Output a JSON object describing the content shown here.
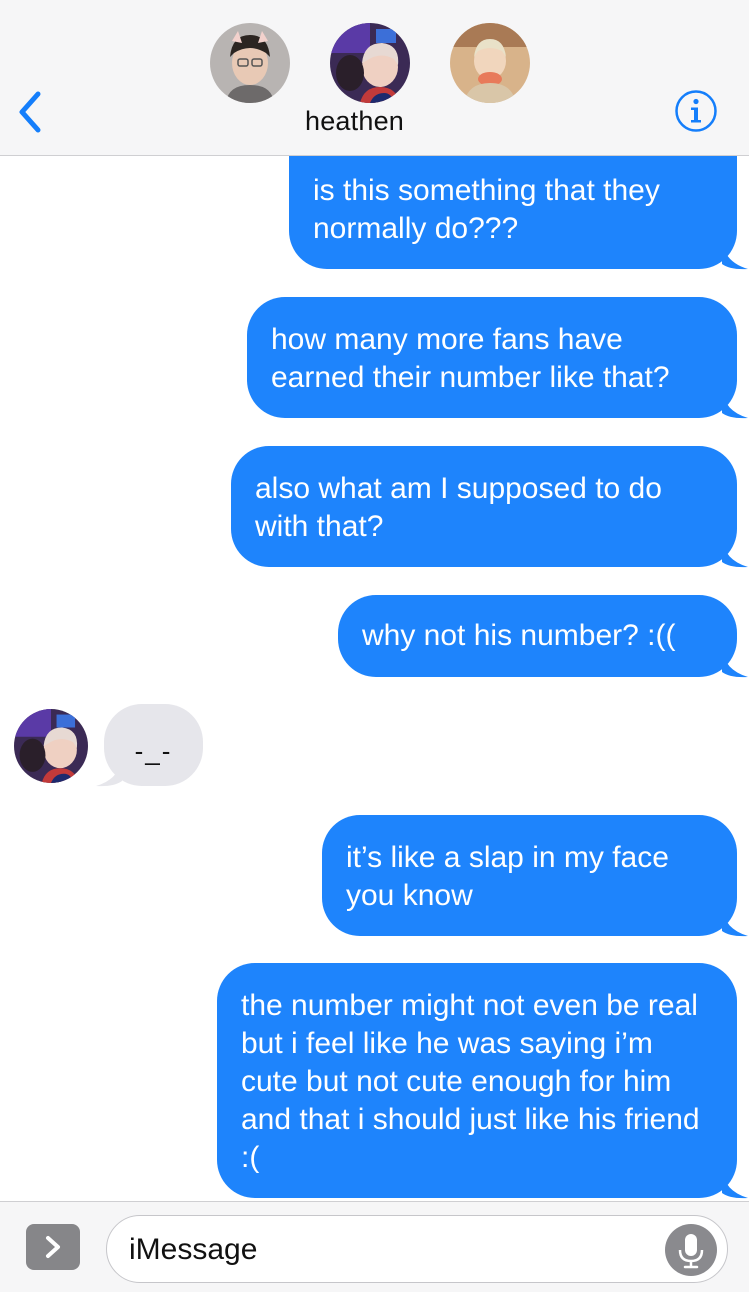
{
  "header": {
    "title": "heathen",
    "back_icon": "chevron-left-icon",
    "info_icon": "info-icon",
    "accent_color": "#147efb"
  },
  "messages": [
    {
      "direction": "outgoing",
      "text": "is this something that they normally do???"
    },
    {
      "direction": "outgoing",
      "text": "how many more fans have earned their number like that?"
    },
    {
      "direction": "outgoing",
      "text": "also what am I supposed to do with that?"
    },
    {
      "direction": "outgoing",
      "text": "why not his number? :(("
    },
    {
      "direction": "incoming",
      "text": "-_-"
    },
    {
      "direction": "outgoing",
      "text": "it’s like a slap in my face you know"
    },
    {
      "direction": "outgoing",
      "text": "the number might not even be real but i feel like he was saying i’m cute but not cute enough for him and that i should just like his friend :("
    }
  ],
  "composer": {
    "placeholder": "iMessage",
    "apps_icon": "chevron-right-icon",
    "mic_icon": "microphone-icon"
  },
  "colors": {
    "outgoing_bubble": "#1e84fc",
    "incoming_bubble": "#e6e6eb",
    "header_bg": "#f6f6f7"
  }
}
